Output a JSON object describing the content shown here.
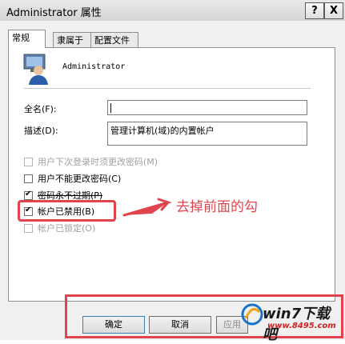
{
  "window": {
    "title": "Administrator 属性",
    "help_label": "?",
    "close_label": "X"
  },
  "tabs": [
    "常规",
    "隶属于",
    "配置文件"
  ],
  "user": {
    "name": "Administrator"
  },
  "form": {
    "fullname_label": "全名(F):",
    "fullname_value": "",
    "desc_label": "描述(D):",
    "desc_value": "管理计算机(域)的内置帐户"
  },
  "checkboxes": [
    {
      "label": "用户下次登录时须更改密码(M)",
      "checked": false,
      "disabled": true
    },
    {
      "label": "用户不能更改密码(C)",
      "checked": false,
      "disabled": false
    },
    {
      "label": "密码永不过期(P)",
      "checked": true,
      "disabled": false
    },
    {
      "label": "帐户已禁用(B)",
      "checked": true,
      "disabled": false
    },
    {
      "label": "帐户已锁定(O)",
      "checked": false,
      "disabled": true
    }
  ],
  "annotation": {
    "text": "去掉前面的勾",
    "color": "#e0444f"
  },
  "buttons": {
    "ok": "确定",
    "cancel": "取消",
    "apply": "应用"
  },
  "watermark": {
    "brand": "win7下载吧",
    "url": "www.8495.com"
  }
}
